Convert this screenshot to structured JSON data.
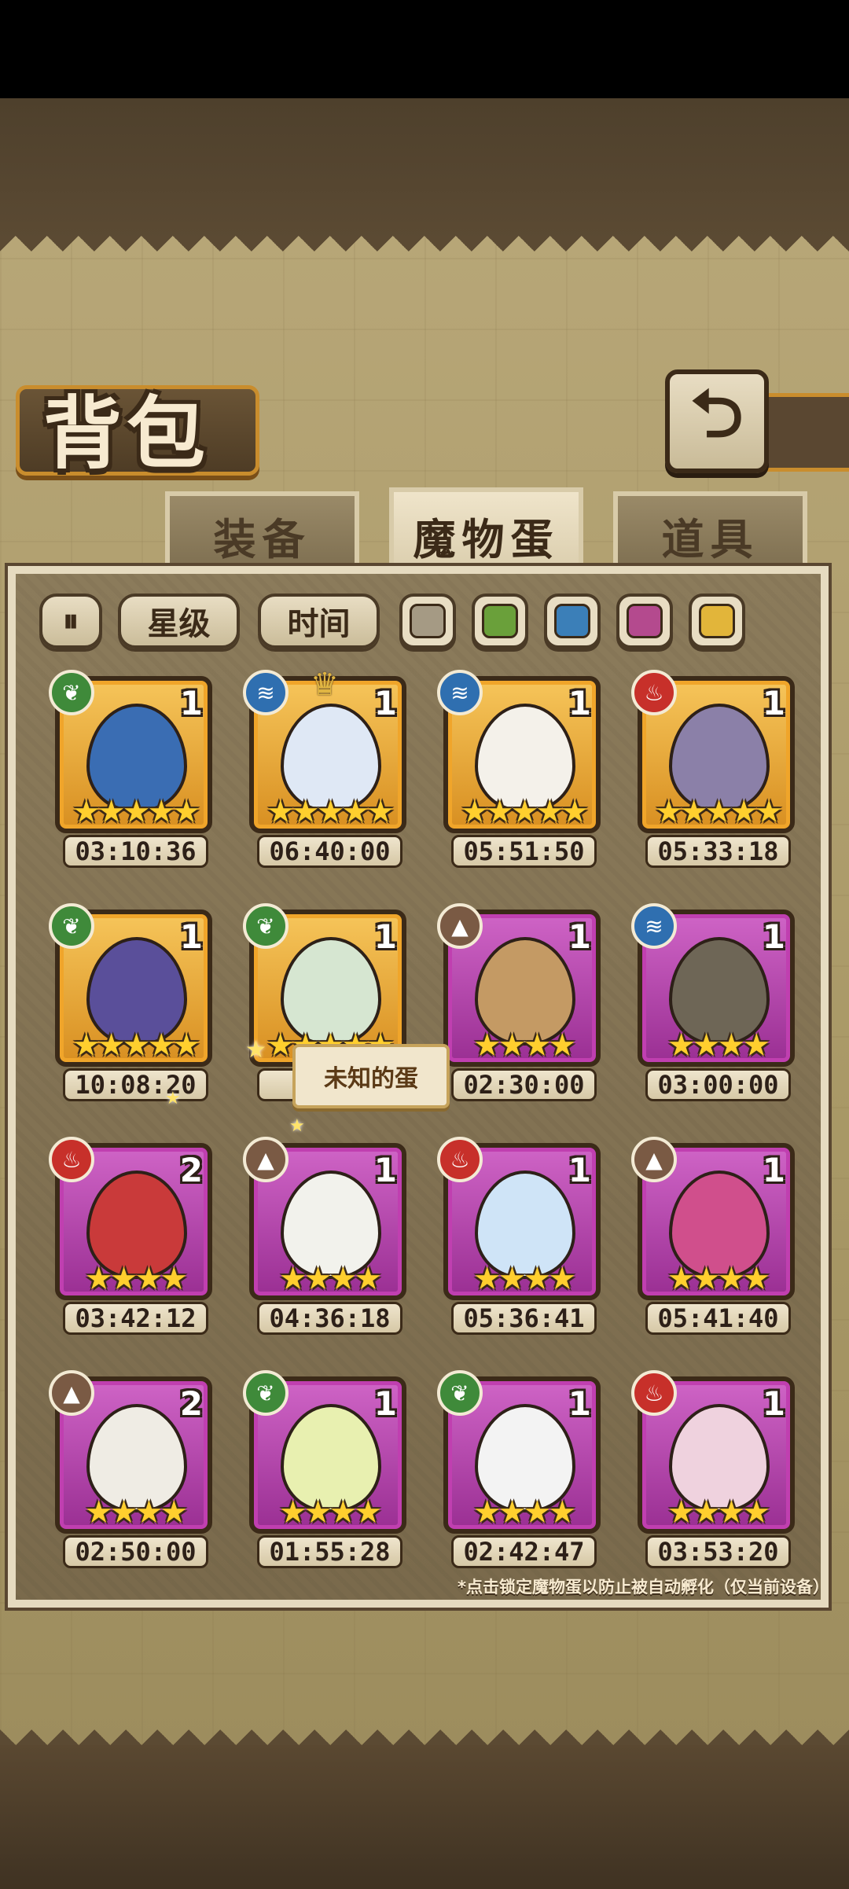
{
  "header": {
    "title": "背包",
    "back_icon": "return-arrow-icon"
  },
  "tabs": [
    {
      "label": "装备",
      "active": false
    },
    {
      "label": "魔物蛋",
      "active": true
    },
    {
      "label": "道具",
      "active": false
    }
  ],
  "filters": {
    "sort_toggle_icon": "sort-toggle-icon",
    "star_label": "星级",
    "time_label": "时间",
    "swatches": [
      "#a59a84",
      "#6aa03a",
      "#3b7fb8",
      "#b44a8e",
      "#e2b53a"
    ]
  },
  "eggs": [
    {
      "count": "1",
      "time": "03:10:36",
      "stars": "★★★★★",
      "element": "leaf",
      "rim": "#f0a52a",
      "egg": "#3a6db3"
    },
    {
      "count": "1",
      "time": "06:40:00",
      "stars": "★★★★★",
      "element": "water",
      "rim": "#f0a52a",
      "egg": "#dfe8f5"
    },
    {
      "count": "1",
      "time": "05:51:50",
      "stars": "★★★★★",
      "element": "water",
      "rim": "#f0a52a",
      "egg": "#f4f1ea"
    },
    {
      "count": "1",
      "time": "05:33:18",
      "stars": "★★★★★",
      "element": "fire",
      "rim": "#f0a52a",
      "egg": "#8b80a8"
    },
    {
      "count": "1",
      "time": "10:08:20",
      "stars": "★★★★★",
      "element": "leaf",
      "rim": "#f0a52a",
      "egg": "#5a4f9a"
    },
    {
      "count": "1",
      "time": "0",
      "stars": "★★★★★",
      "element": "leaf",
      "rim": "#f0a52a",
      "egg": "#d6e6d1"
    },
    {
      "count": "1",
      "time": "02:30:00",
      "stars": "★★★★",
      "element": "earth",
      "rim": "#c03fb0",
      "egg": "#c49a64"
    },
    {
      "count": "1",
      "time": "03:00:00",
      "stars": "★★★★",
      "element": "water",
      "rim": "#c03fb0",
      "egg": "#6e6656"
    },
    {
      "count": "2",
      "time": "03:42:12",
      "stars": "★★★★",
      "element": "fire",
      "rim": "#c03fb0",
      "egg": "#c93a3a"
    },
    {
      "count": "1",
      "time": "04:36:18",
      "stars": "★★★★",
      "element": "earth",
      "rim": "#c03fb0",
      "egg": "#f2f2ec"
    },
    {
      "count": "1",
      "time": "05:36:41",
      "stars": "★★★★",
      "element": "fire",
      "rim": "#c03fb0",
      "egg": "#cfe4f7"
    },
    {
      "count": "1",
      "time": "05:41:40",
      "stars": "★★★★",
      "element": "earth",
      "rim": "#c03fb0",
      "egg": "#d04f8c"
    },
    {
      "count": "2",
      "time": "02:50:00",
      "stars": "★★★★",
      "element": "earth",
      "rim": "#c03fb0",
      "egg": "#efece4"
    },
    {
      "count": "1",
      "time": "01:55:28",
      "stars": "★★★★",
      "element": "leaf",
      "rim": "#c03fb0",
      "egg": "#e8f0b0"
    },
    {
      "count": "1",
      "time": "02:42:47",
      "stars": "★★★★",
      "element": "leaf",
      "rim": "#c03fb0",
      "egg": "#f3f3f3"
    },
    {
      "count": "1",
      "time": "03:53:20",
      "stars": "★★★★",
      "element": "fire",
      "rim": "#c03fb0",
      "egg": "#efd2de"
    }
  ],
  "tooltip": "未知的蛋",
  "footer_note": "*点击锁定魔物蛋以防止被自动孵化（仅当前设备）"
}
